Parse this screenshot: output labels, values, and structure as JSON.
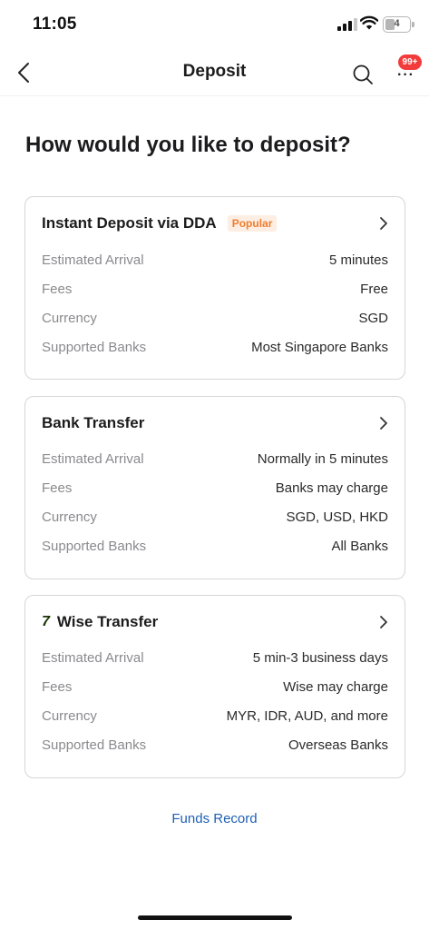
{
  "status_bar": {
    "time": "11:05",
    "battery": "4"
  },
  "nav": {
    "title": "Deposit",
    "badge": "99+"
  },
  "heading": "How would you like to deposit?",
  "methods": [
    {
      "title": "Instant Deposit via DDA",
      "tag": "Popular",
      "rows": [
        {
          "label": "Estimated Arrival",
          "value": "5 minutes"
        },
        {
          "label": "Fees",
          "value": "Free"
        },
        {
          "label": "Currency",
          "value": "SGD"
        },
        {
          "label": "Supported Banks",
          "value": "Most Singapore Banks"
        }
      ]
    },
    {
      "title": "Bank Transfer",
      "rows": [
        {
          "label": "Estimated Arrival",
          "value": "Normally in 5 minutes"
        },
        {
          "label": "Fees",
          "value": "Banks may charge"
        },
        {
          "label": "Currency",
          "value": "SGD, USD, HKD"
        },
        {
          "label": "Supported Banks",
          "value": "All Banks"
        }
      ]
    },
    {
      "title": "Wise Transfer",
      "icon": "wise-logo-icon",
      "rows": [
        {
          "label": "Estimated Arrival",
          "value": "5 min-3 business days"
        },
        {
          "label": "Fees",
          "value": "Wise may charge"
        },
        {
          "label": "Currency",
          "value": "MYR, IDR, AUD, and more"
        },
        {
          "label": "Supported Banks",
          "value": "Overseas Banks"
        }
      ]
    }
  ],
  "footer_link": "Funds Record",
  "colors": {
    "popular_tag": "#ef7d2e",
    "link": "#1f5fb3",
    "badge": "#f23b3b"
  }
}
